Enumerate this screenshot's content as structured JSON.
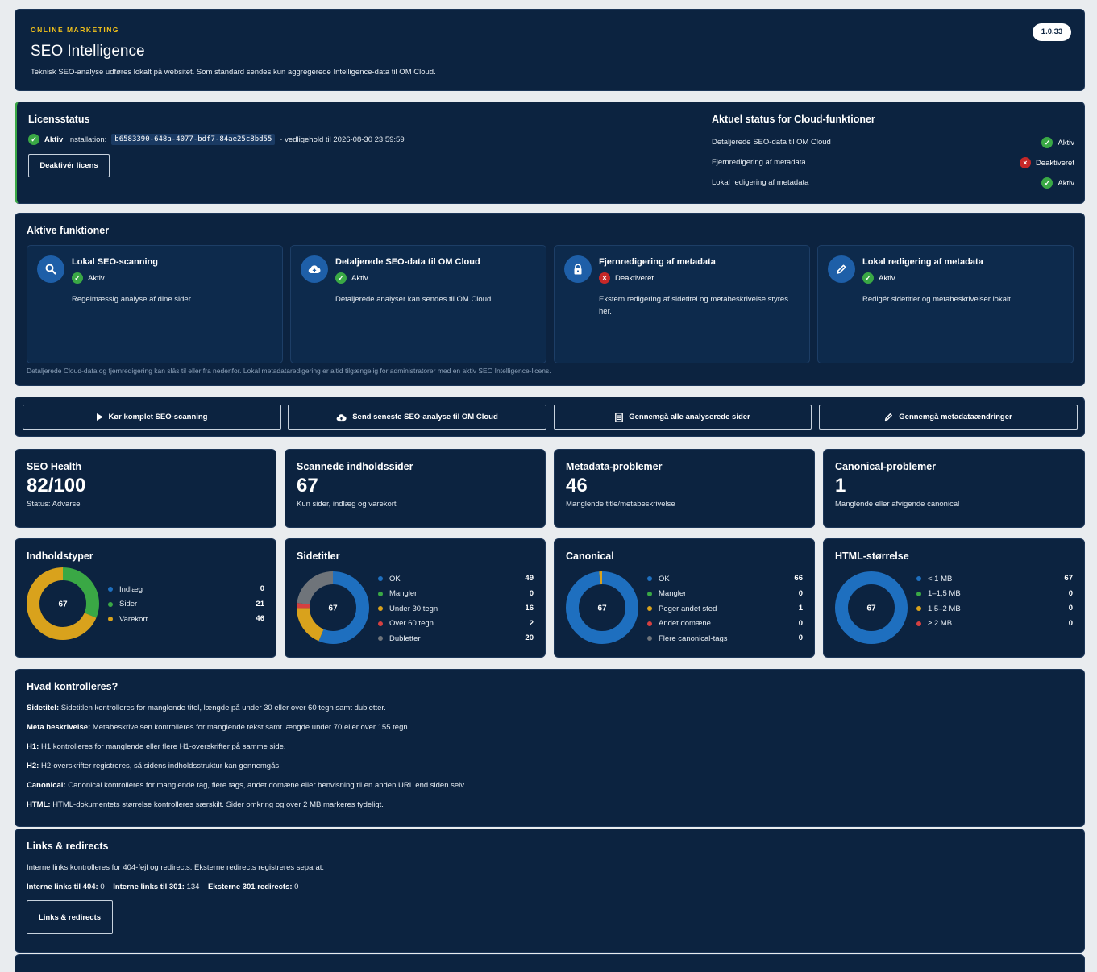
{
  "header": {
    "eyebrow": "ONLINE MARKETING",
    "title": "SEO Intelligence",
    "subtitle": "Teknisk SEO-analyse udføres lokalt på websitet. Som standard sendes kun aggregerede Intelligence-data til OM Cloud.",
    "version": "1.0.33"
  },
  "license": {
    "title": "Licensstatus",
    "status": "Aktiv",
    "installation_label": "Installation:",
    "installation_id": "b6583390-648a-4077-bdf7-84ae25c8bd55",
    "maintenance": "· vedligehold til 2026-08-30 23:59:59",
    "deactivate_label": "Deaktivér licens"
  },
  "cloud_status": {
    "title": "Aktuel status for Cloud-funktioner",
    "items": [
      {
        "label": "Detaljerede SEO-data til OM Cloud",
        "status": "Aktiv"
      },
      {
        "label": "Fjernredigering af metadata",
        "status": "Deaktiveret"
      },
      {
        "label": "Lokal redigering af metadata",
        "status": "Aktiv"
      }
    ]
  },
  "features": {
    "title": "Aktive funktioner",
    "items": [
      {
        "title": "Lokal SEO-scanning",
        "status": "Aktiv",
        "desc": "Regelmæssig analyse af dine sider.",
        "icon": "search-icon"
      },
      {
        "title": "Detaljerede SEO-data til OM Cloud",
        "status": "Aktiv",
        "desc": "Detaljerede analyser kan sendes til OM Cloud.",
        "icon": "cloud-upload-icon"
      },
      {
        "title": "Fjernredigering af metadata",
        "status": "Deaktiveret",
        "desc": "Ekstern redigering af sidetitel og metabeskrivelse styres her.",
        "icon": "lock-icon"
      },
      {
        "title": "Lokal redigering af metadata",
        "status": "Aktiv",
        "desc": "Redigér sidetitler og metabeskrivelser lokalt.",
        "icon": "pencil-icon"
      }
    ],
    "note": "Detaljerede Cloud-data og fjernredigering kan slås til eller fra nedenfor. Lokal metadataredigering er altid tilgængelig for administratorer med en aktiv SEO Intelligence-licens."
  },
  "actions": [
    {
      "label": "Kør komplet SEO-scanning",
      "icon": "play-icon"
    },
    {
      "label": "Send seneste SEO-analyse til OM Cloud",
      "icon": "cloud-upload-icon"
    },
    {
      "label": "Gennemgå alle analyserede sider",
      "icon": "document-list-icon"
    },
    {
      "label": "Gennemgå metadataændringer",
      "icon": "pencil-icon"
    }
  ],
  "stats": [
    {
      "title": "SEO Health",
      "value": "82/100",
      "sub": "Status: Advarsel"
    },
    {
      "title": "Scannede indholdssider",
      "value": "67",
      "sub": "Kun sider, indlæg og varekort"
    },
    {
      "title": "Metadata-problemer",
      "value": "46",
      "sub": "Manglende title/metabeskrivelse"
    },
    {
      "title": "Canonical-problemer",
      "value": "1",
      "sub": "Manglende eller afvigende canonical"
    }
  ],
  "colors": {
    "blue": "#1e6fbf",
    "green": "#3aa845",
    "yellow": "#d9a21c",
    "red": "#d64040",
    "gray": "#6f747a"
  },
  "chart_data": [
    {
      "type": "pie",
      "title": "Indholdstyper",
      "center": "67",
      "categories": [
        "Indlæg",
        "Sider",
        "Varekort"
      ],
      "values": [
        0,
        21,
        46
      ],
      "colors": [
        "#1e6fbf",
        "#3aa845",
        "#d9a21c"
      ]
    },
    {
      "type": "pie",
      "title": "Sidetitler",
      "center": "67",
      "categories": [
        "OK",
        "Mangler",
        "Under 30 tegn",
        "Over 60 tegn",
        "Dubletter"
      ],
      "values": [
        49,
        0,
        16,
        2,
        20
      ],
      "colors": [
        "#1e6fbf",
        "#3aa845",
        "#d9a21c",
        "#d64040",
        "#6f747a"
      ]
    },
    {
      "type": "pie",
      "title": "Canonical",
      "center": "67",
      "categories": [
        "OK",
        "Mangler",
        "Peger andet sted",
        "Andet domæne",
        "Flere canonical-tags"
      ],
      "values": [
        66,
        0,
        1,
        0,
        0
      ],
      "colors": [
        "#1e6fbf",
        "#3aa845",
        "#d9a21c",
        "#d64040",
        "#6f747a"
      ]
    },
    {
      "type": "pie",
      "title": "HTML-størrelse",
      "center": "67",
      "categories": [
        "< 1 MB",
        "1–1,5 MB",
        "1,5–2 MB",
        "≥ 2 MB"
      ],
      "values": [
        67,
        0,
        0,
        0
      ],
      "colors": [
        "#1e6fbf",
        "#3aa845",
        "#d9a21c",
        "#d64040"
      ]
    }
  ],
  "checks": {
    "title": "Hvad kontrolleres?",
    "items": [
      {
        "label": "Sidetitel:",
        "text": "Sidetitlen kontrolleres for manglende titel, længde på under 30 eller over 60 tegn samt dubletter."
      },
      {
        "label": "Meta beskrivelse:",
        "text": "Metabeskrivelsen kontrolleres for manglende tekst samt længde under 70 eller over 155 tegn."
      },
      {
        "label": "H1:",
        "text": "H1 kontrolleres for manglende eller flere H1-overskrifter på samme side."
      },
      {
        "label": "H2:",
        "text": "H2-overskrifter registreres, så sidens indholdsstruktur kan gennemgås."
      },
      {
        "label": "Canonical:",
        "text": "Canonical kontrolleres for manglende tag, flere tags, andet domæne eller henvisning til en anden URL end siden selv."
      },
      {
        "label": "HTML:",
        "text": "HTML-dokumentets størrelse kontrolleres særskilt. Sider omkring og over 2 MB markeres tydeligt."
      }
    ]
  },
  "links": {
    "title": "Links & redirects",
    "desc": "Interne links kontrolleres for 404-fejl og redirects. Eksterne redirects registreres separat.",
    "internal_404_label": "Interne links til 404:",
    "internal_404": "0",
    "internal_301_label": "Interne links til 301:",
    "internal_301": "134",
    "external_301_label": "Eksterne 301 redirects:",
    "external_301": "0",
    "button": "Links & redirects"
  }
}
